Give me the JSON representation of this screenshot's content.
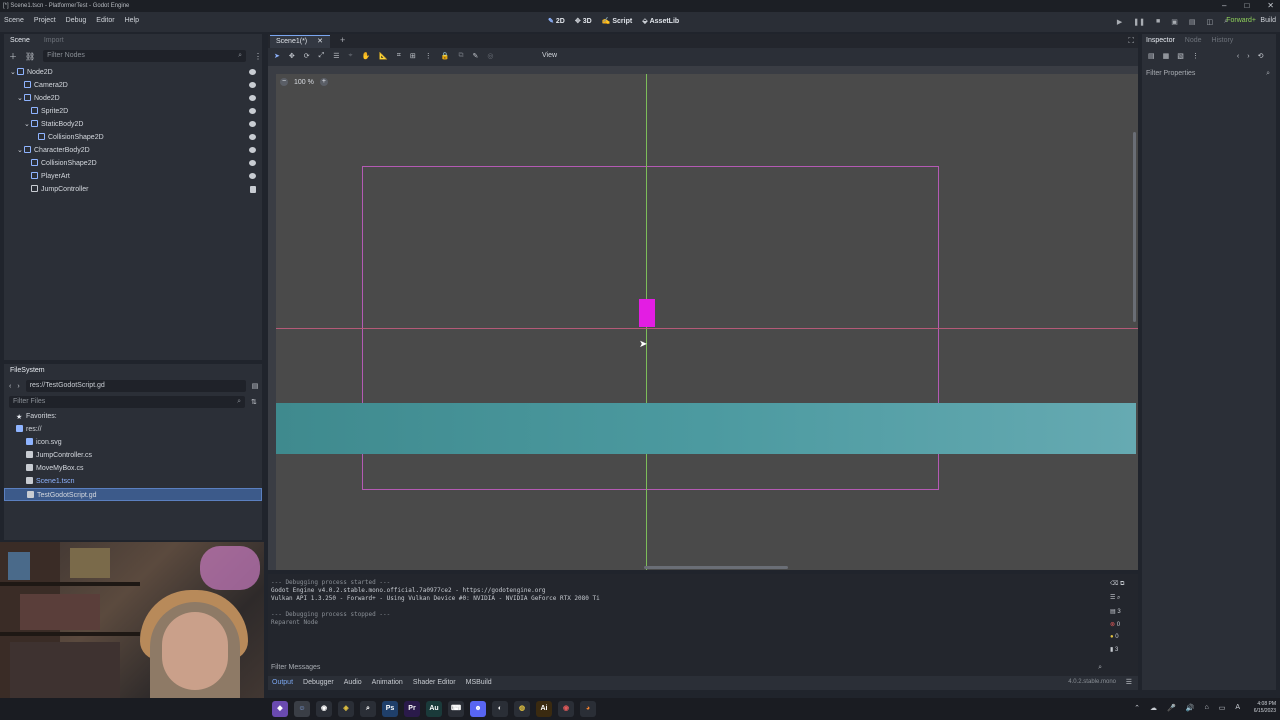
{
  "window": {
    "title": "[*] Scene1.tscn - PlatformerTest - Godot Engine"
  },
  "window_controls": [
    "–",
    "□",
    "✕"
  ],
  "menubar": {
    "items": [
      "Scene",
      "Project",
      "Debug",
      "Editor",
      "Help"
    ]
  },
  "workspaces": [
    {
      "icon": "2d-icon",
      "label": "2D"
    },
    {
      "icon": "3d-icon",
      "label": "3D"
    },
    {
      "icon": "script-icon",
      "label": "Script"
    },
    {
      "icon": "assetlib-icon",
      "label": "AssetLib"
    }
  ],
  "renderer": "Forward+",
  "build_label": "Build",
  "scene_dock": {
    "tabs": [
      "Scene",
      "Import"
    ],
    "filter_placeholder": "Filter Nodes",
    "nodes": [
      {
        "label": "Node2D",
        "depth": 0,
        "icon": "node2d-icon",
        "color": "#8fb4ff"
      },
      {
        "label": "Camera2D",
        "depth": 1,
        "icon": "camera2d-icon",
        "color": "#8fb4ff"
      },
      {
        "label": "Node2D",
        "depth": 1,
        "icon": "node2d-icon",
        "color": "#8fb4ff"
      },
      {
        "label": "Sprite2D",
        "depth": 2,
        "icon": "sprite2d-icon",
        "color": "#8fb4ff"
      },
      {
        "label": "StaticBody2D",
        "depth": 2,
        "icon": "staticbody2d-icon",
        "color": "#8fb4ff"
      },
      {
        "label": "CollisionShape2D",
        "depth": 3,
        "icon": "collisionshape2d-icon",
        "color": "#8fb4ff"
      },
      {
        "label": "CharacterBody2D",
        "depth": 1,
        "icon": "characterbody2d-icon",
        "color": "#8fb4ff"
      },
      {
        "label": "CollisionShape2D",
        "depth": 2,
        "icon": "collisionshape2d-icon",
        "color": "#8fb4ff"
      },
      {
        "label": "PlayerArt",
        "depth": 2,
        "icon": "sprite2d-icon",
        "color": "#8fb4ff"
      },
      {
        "label": "JumpController",
        "depth": 2,
        "icon": "node-icon",
        "color": "#c8ccd2"
      }
    ]
  },
  "filesystem": {
    "tab": "FileSystem",
    "path": "res://TestGodotScript.gd",
    "filter_placeholder": "Filter Files",
    "items": [
      {
        "label": "Favorites:",
        "depth": 0,
        "icon": "star-icon"
      },
      {
        "label": "res://",
        "depth": 0,
        "icon": "folder-icon"
      },
      {
        "label": "icon.svg",
        "depth": 1,
        "icon": "svg-icon"
      },
      {
        "label": "JumpController.cs",
        "depth": 1,
        "icon": "csharp-icon"
      },
      {
        "label": "MoveMyBox.cs",
        "depth": 1,
        "icon": "csharp-icon"
      },
      {
        "label": "Scene1.tscn",
        "depth": 1,
        "icon": "scene-icon"
      },
      {
        "label": "TestGodotScript.gd",
        "depth": 1,
        "icon": "gdscript-icon",
        "selected": true
      }
    ]
  },
  "editor": {
    "scene_tab": "Scene1(*)",
    "zoom": "100 %",
    "view_menu": "View",
    "player_color": "#e31de3",
    "platform_color": "#4c9aa0"
  },
  "output": {
    "lines": [
      {
        "text": "--- Debugging process started ---",
        "dim": true
      },
      {
        "text": "Godot Engine v4.0.2.stable.mono.official.7a0977ce2 - https://godotengine.org",
        "dim": false
      },
      {
        "text": "Vulkan API 1.3.250 - Forward+ - Using Vulkan Device #0: NVIDIA - NVIDIA GeForce RTX 2080 Ti",
        "dim": false
      },
      {
        "text": "",
        "dim": false
      },
      {
        "text": "--- Debugging process stopped ---",
        "dim": true
      },
      {
        "text": "Reparent Node",
        "dim": true
      }
    ],
    "filter_placeholder": "Filter Messages",
    "counts": {
      "messages": "3",
      "errors": "0",
      "warnings": "0",
      "info": "3"
    }
  },
  "bottom_tabs": [
    "Output",
    "Debugger",
    "Audio",
    "Animation",
    "Shader Editor",
    "MSBuild"
  ],
  "version": "4.0.2.stable.mono",
  "inspector": {
    "tabs": [
      "Inspector",
      "Node",
      "History"
    ],
    "filter_placeholder": "Filter Properties"
  },
  "taskbar": {
    "time": "4:08 PM",
    "date": "6/15/2023"
  }
}
